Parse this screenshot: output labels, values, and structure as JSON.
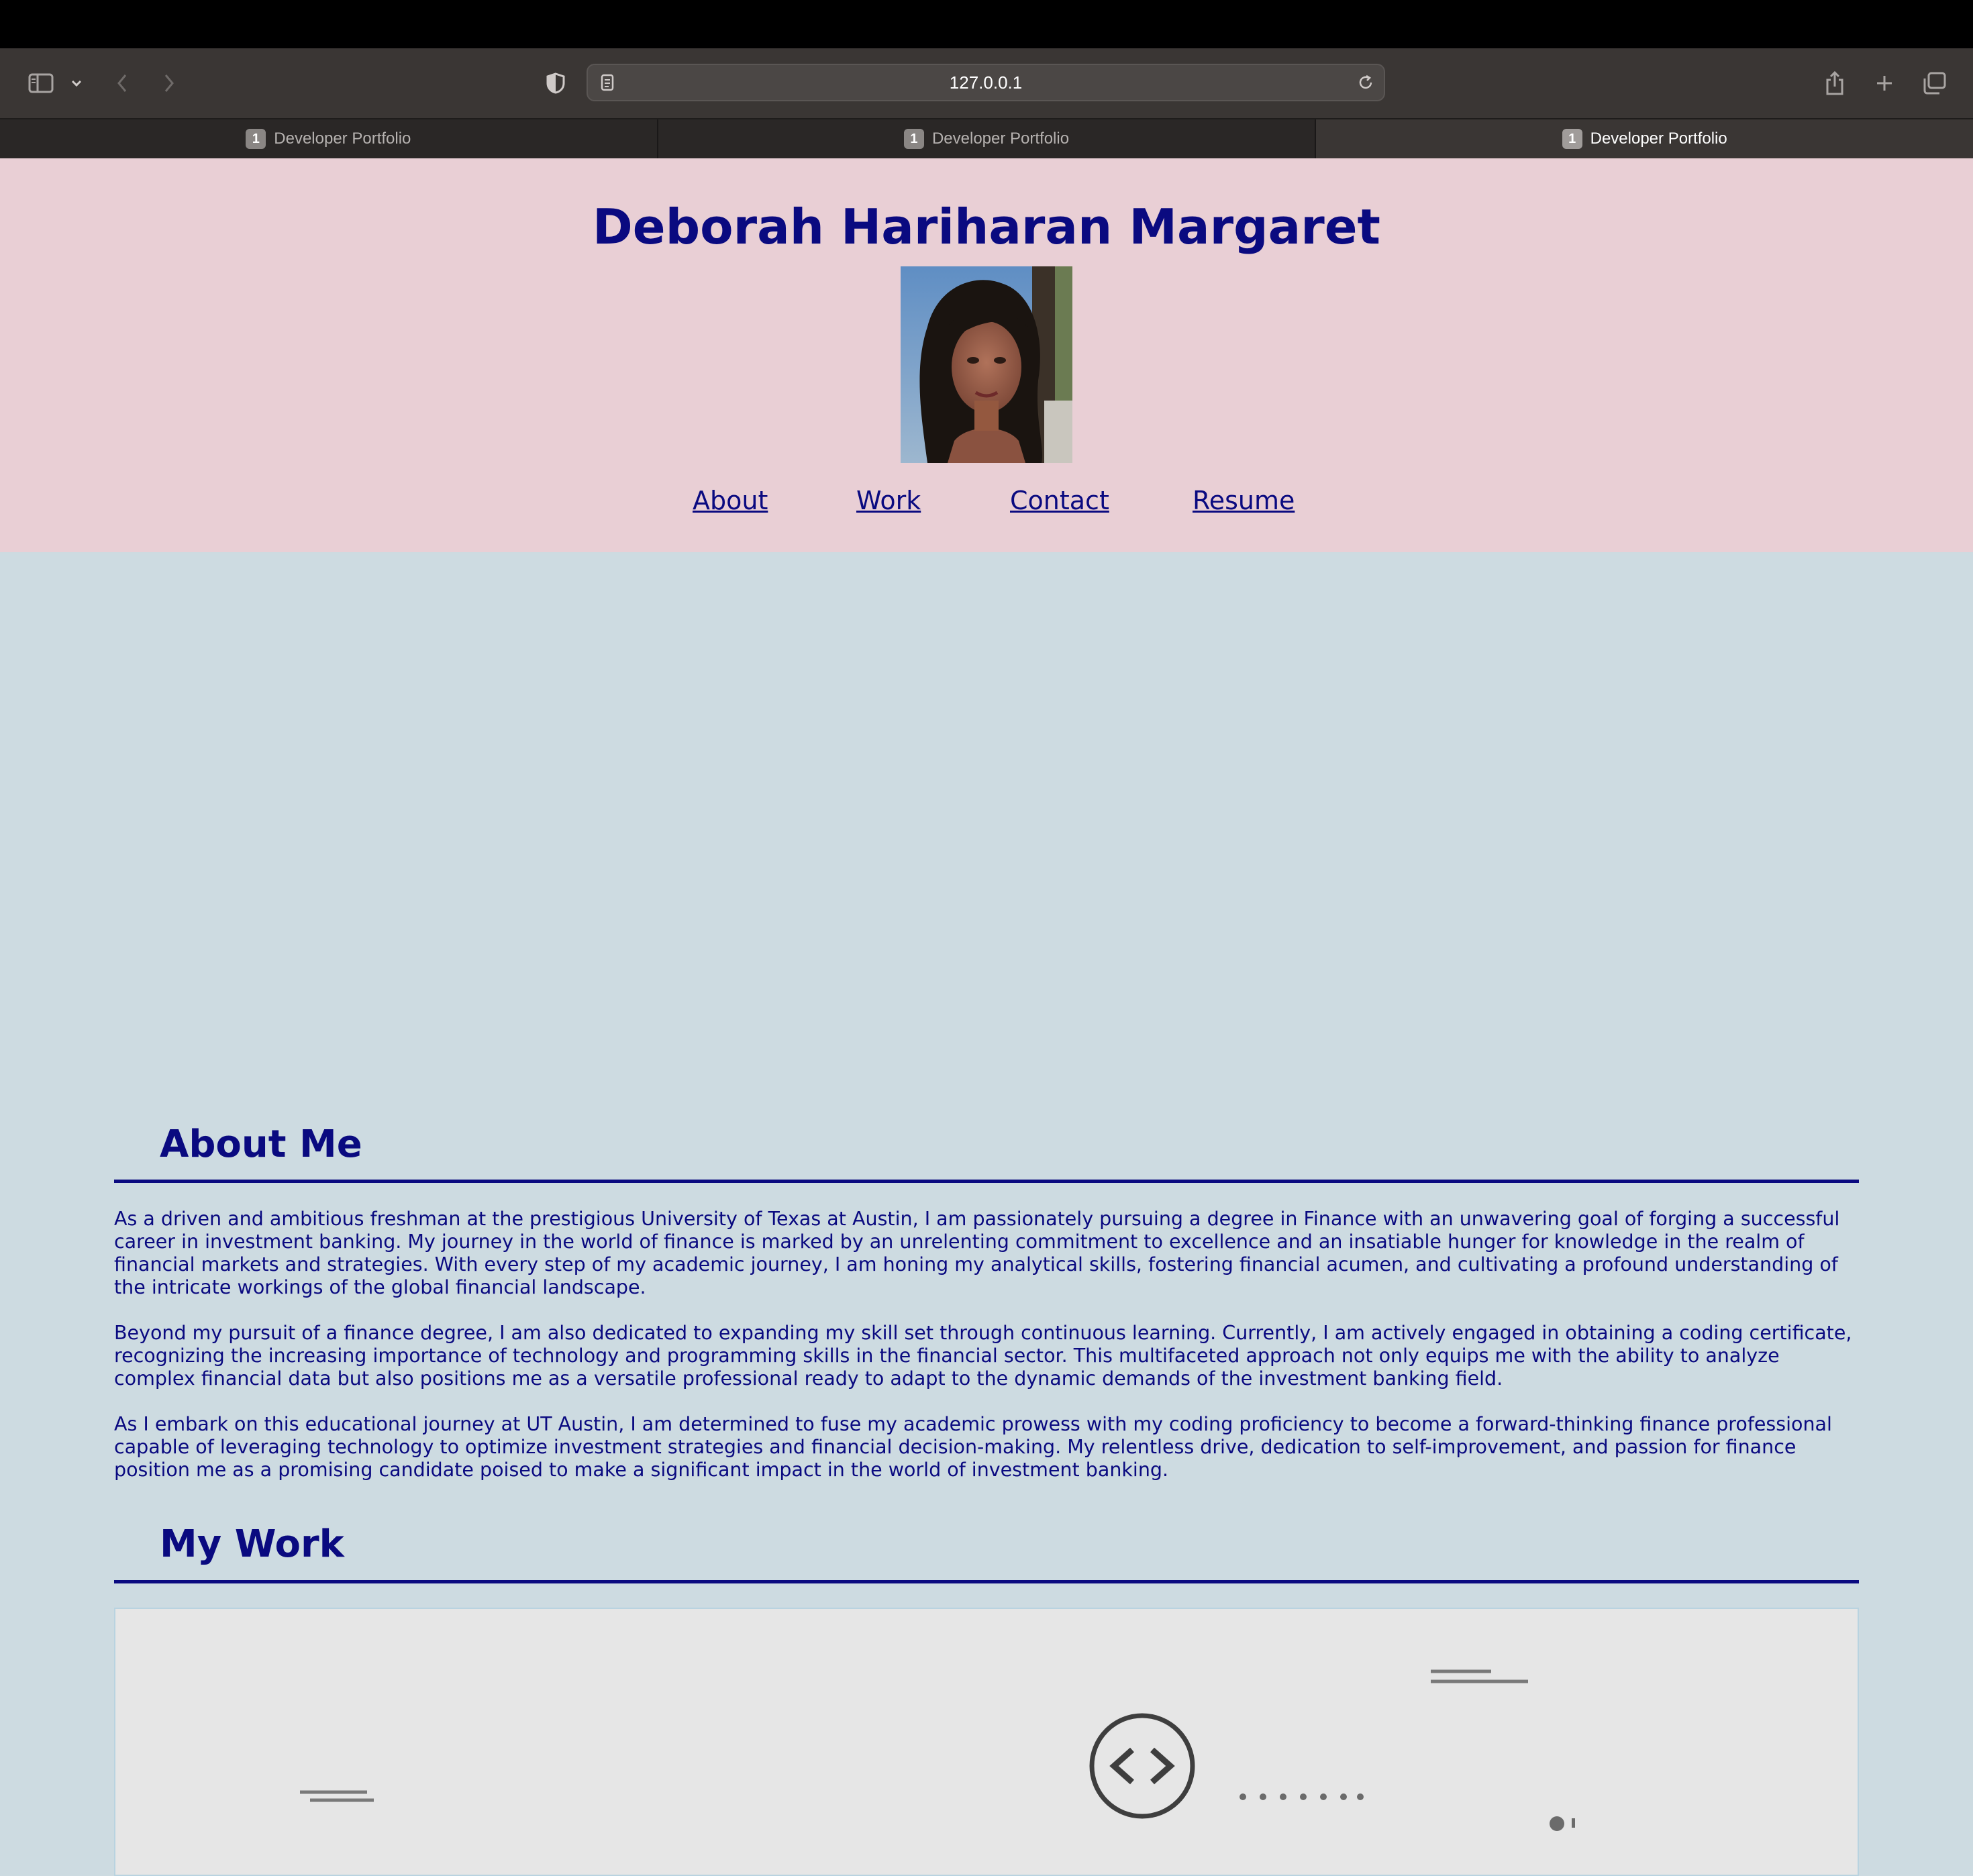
{
  "browser": {
    "url": "127.0.0.1",
    "tabs": [
      {
        "badge": "1",
        "title": "Developer Portfolio",
        "active": false
      },
      {
        "badge": "1",
        "title": "Developer Portfolio",
        "active": false
      },
      {
        "badge": "1",
        "title": "Developer Portfolio",
        "active": true
      }
    ]
  },
  "header": {
    "name": "Deborah Hariharan Margaret",
    "nav": [
      "About",
      "Work",
      "Contact",
      "Resume"
    ]
  },
  "about": {
    "heading": "About Me",
    "paragraphs": [
      "As a driven and ambitious freshman at the prestigious University of Texas at Austin, I am passionately pursuing a degree in Finance with an unwavering goal of forging a successful career in investment banking. My journey in the world of finance is marked by an unrelenting commitment to excellence and an insatiable hunger for knowledge in the realm of financial markets and strategies. With every step of my academic journey, I am honing my analytical skills, fostering financial acumen, and cultivating a profound understanding of the intricate workings of the global financial landscape.",
      "Beyond my pursuit of a finance degree, I am also dedicated to expanding my skill set through continuous learning. Currently, I am actively engaged in obtaining a coding certificate, recognizing the increasing importance of technology and programming skills in the financial sector. This multifaceted approach not only equips me with the ability to analyze complex financial data but also positions me as a versatile professional ready to adapt to the dynamic demands of the investment banking field.",
      "As I embark on this educational journey at UT Austin, I am determined to fuse my academic prowess with my coding proficiency to become a forward-thinking finance professional capable of leveraging technology to optimize investment strategies and financial decision-making. My relentless drive, dedication to self-improvement, and passion for finance position me as a promising candidate poised to make a significant impact in the world of investment banking."
    ]
  },
  "work": {
    "heading": "My Work",
    "card_icon": "code-icon"
  },
  "colors": {
    "header_bg": "#e9cfd5",
    "page_bg": "#cddbe1",
    "text": "#0a0a80"
  }
}
